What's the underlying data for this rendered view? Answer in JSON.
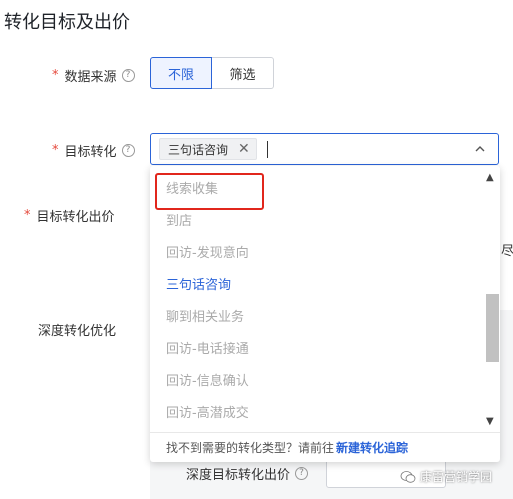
{
  "section_title": "转化目标及出价",
  "data_source": {
    "label": "数据来源",
    "options": [
      "不限",
      "筛选"
    ],
    "selected": "不限"
  },
  "target_conversion": {
    "label": "目标转化",
    "tag": "三句话咨询",
    "dropdown": {
      "options": [
        "线索收集",
        "到店",
        "回访-发现意向",
        "三句话咨询",
        "聊到相关业务",
        "回访-电话接通",
        "回访-信息确认",
        "回访-高潜成交"
      ],
      "selected": "三句话咨询",
      "footer_text": "找不到需要的转化类型？请前往",
      "footer_link": "新建转化追踪"
    }
  },
  "target_bid": {
    "label": "目标转化出价",
    "partial_text": "尽"
  },
  "deep_conversion": {
    "label": "深度转化优化"
  },
  "deep_bid": {
    "label": "深度目标转化出价"
  },
  "watermark": {
    "text": "康雷营销学园"
  },
  "colors": {
    "accent": "#2b64d8",
    "required": "#e5483b",
    "highlight": "#e1261c"
  }
}
